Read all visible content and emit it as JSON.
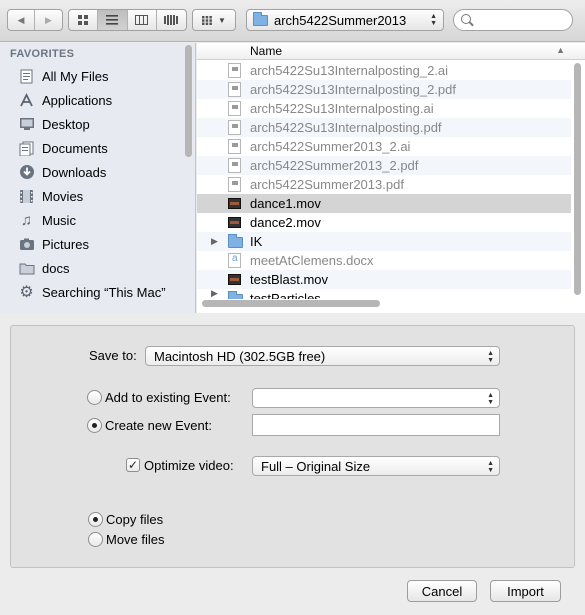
{
  "toolbar": {
    "back_icon": "◀",
    "forward_icon": "▶",
    "path_folder": "arch5422Summer2013",
    "view_modes": [
      "icon-view",
      "list-view",
      "column-view",
      "coverflow-view"
    ],
    "selected_view": "list-view"
  },
  "sidebar": {
    "heading": "FAVORITES",
    "items": [
      {
        "label": "All My Files",
        "icon": "all-files-icon"
      },
      {
        "label": "Applications",
        "icon": "applications-icon"
      },
      {
        "label": "Desktop",
        "icon": "desktop-icon"
      },
      {
        "label": "Documents",
        "icon": "documents-icon"
      },
      {
        "label": "Downloads",
        "icon": "downloads-icon"
      },
      {
        "label": "Movies",
        "icon": "movies-icon"
      },
      {
        "label": "Music",
        "icon": "music-icon"
      },
      {
        "label": "Pictures",
        "icon": "pictures-icon"
      },
      {
        "label": "docs",
        "icon": "folder-icon"
      },
      {
        "label": "Searching “This Mac”",
        "icon": "gear-icon"
      }
    ]
  },
  "filelist": {
    "column_name": "Name",
    "files": [
      {
        "name": "arch5422Su13Internalposting_2.ai",
        "kind": "doc",
        "enabled": false
      },
      {
        "name": "arch5422Su13Internalposting_2.pdf",
        "kind": "doc",
        "enabled": false
      },
      {
        "name": "arch5422Su13Internalposting.ai",
        "kind": "doc",
        "enabled": false
      },
      {
        "name": "arch5422Su13Internalposting.pdf",
        "kind": "doc",
        "enabled": false
      },
      {
        "name": "arch5422Summer2013_2.ai",
        "kind": "doc",
        "enabled": false
      },
      {
        "name": "arch5422Summer2013_2.pdf",
        "kind": "doc",
        "enabled": false
      },
      {
        "name": "arch5422Summer2013.pdf",
        "kind": "doc",
        "enabled": false
      },
      {
        "name": "dance1.mov",
        "kind": "mov",
        "enabled": true,
        "selected": true
      },
      {
        "name": "dance2.mov",
        "kind": "mov",
        "enabled": true
      },
      {
        "name": "IK",
        "kind": "folder",
        "enabled": true
      },
      {
        "name": "meetAtClemens.docx",
        "kind": "docx",
        "enabled": false
      },
      {
        "name": "testBlast.mov",
        "kind": "mov",
        "enabled": true
      },
      {
        "name": "testParticles",
        "kind": "folder",
        "enabled": true
      }
    ]
  },
  "options": {
    "save_to_label": "Save to:",
    "save_to_value": "Macintosh HD (302.5GB free)",
    "add_existing_label": "Add to existing Event:",
    "add_existing_value": "",
    "create_new_label": "Create new Event:",
    "create_new_value": "",
    "event_choice": "create-new",
    "optimize_label": "Optimize video:",
    "optimize_checked": true,
    "optimize_value": "Full – Original Size",
    "copy_label": "Copy files",
    "move_label": "Move files",
    "file_choice": "copy"
  },
  "buttons": {
    "cancel": "Cancel",
    "import": "Import"
  }
}
